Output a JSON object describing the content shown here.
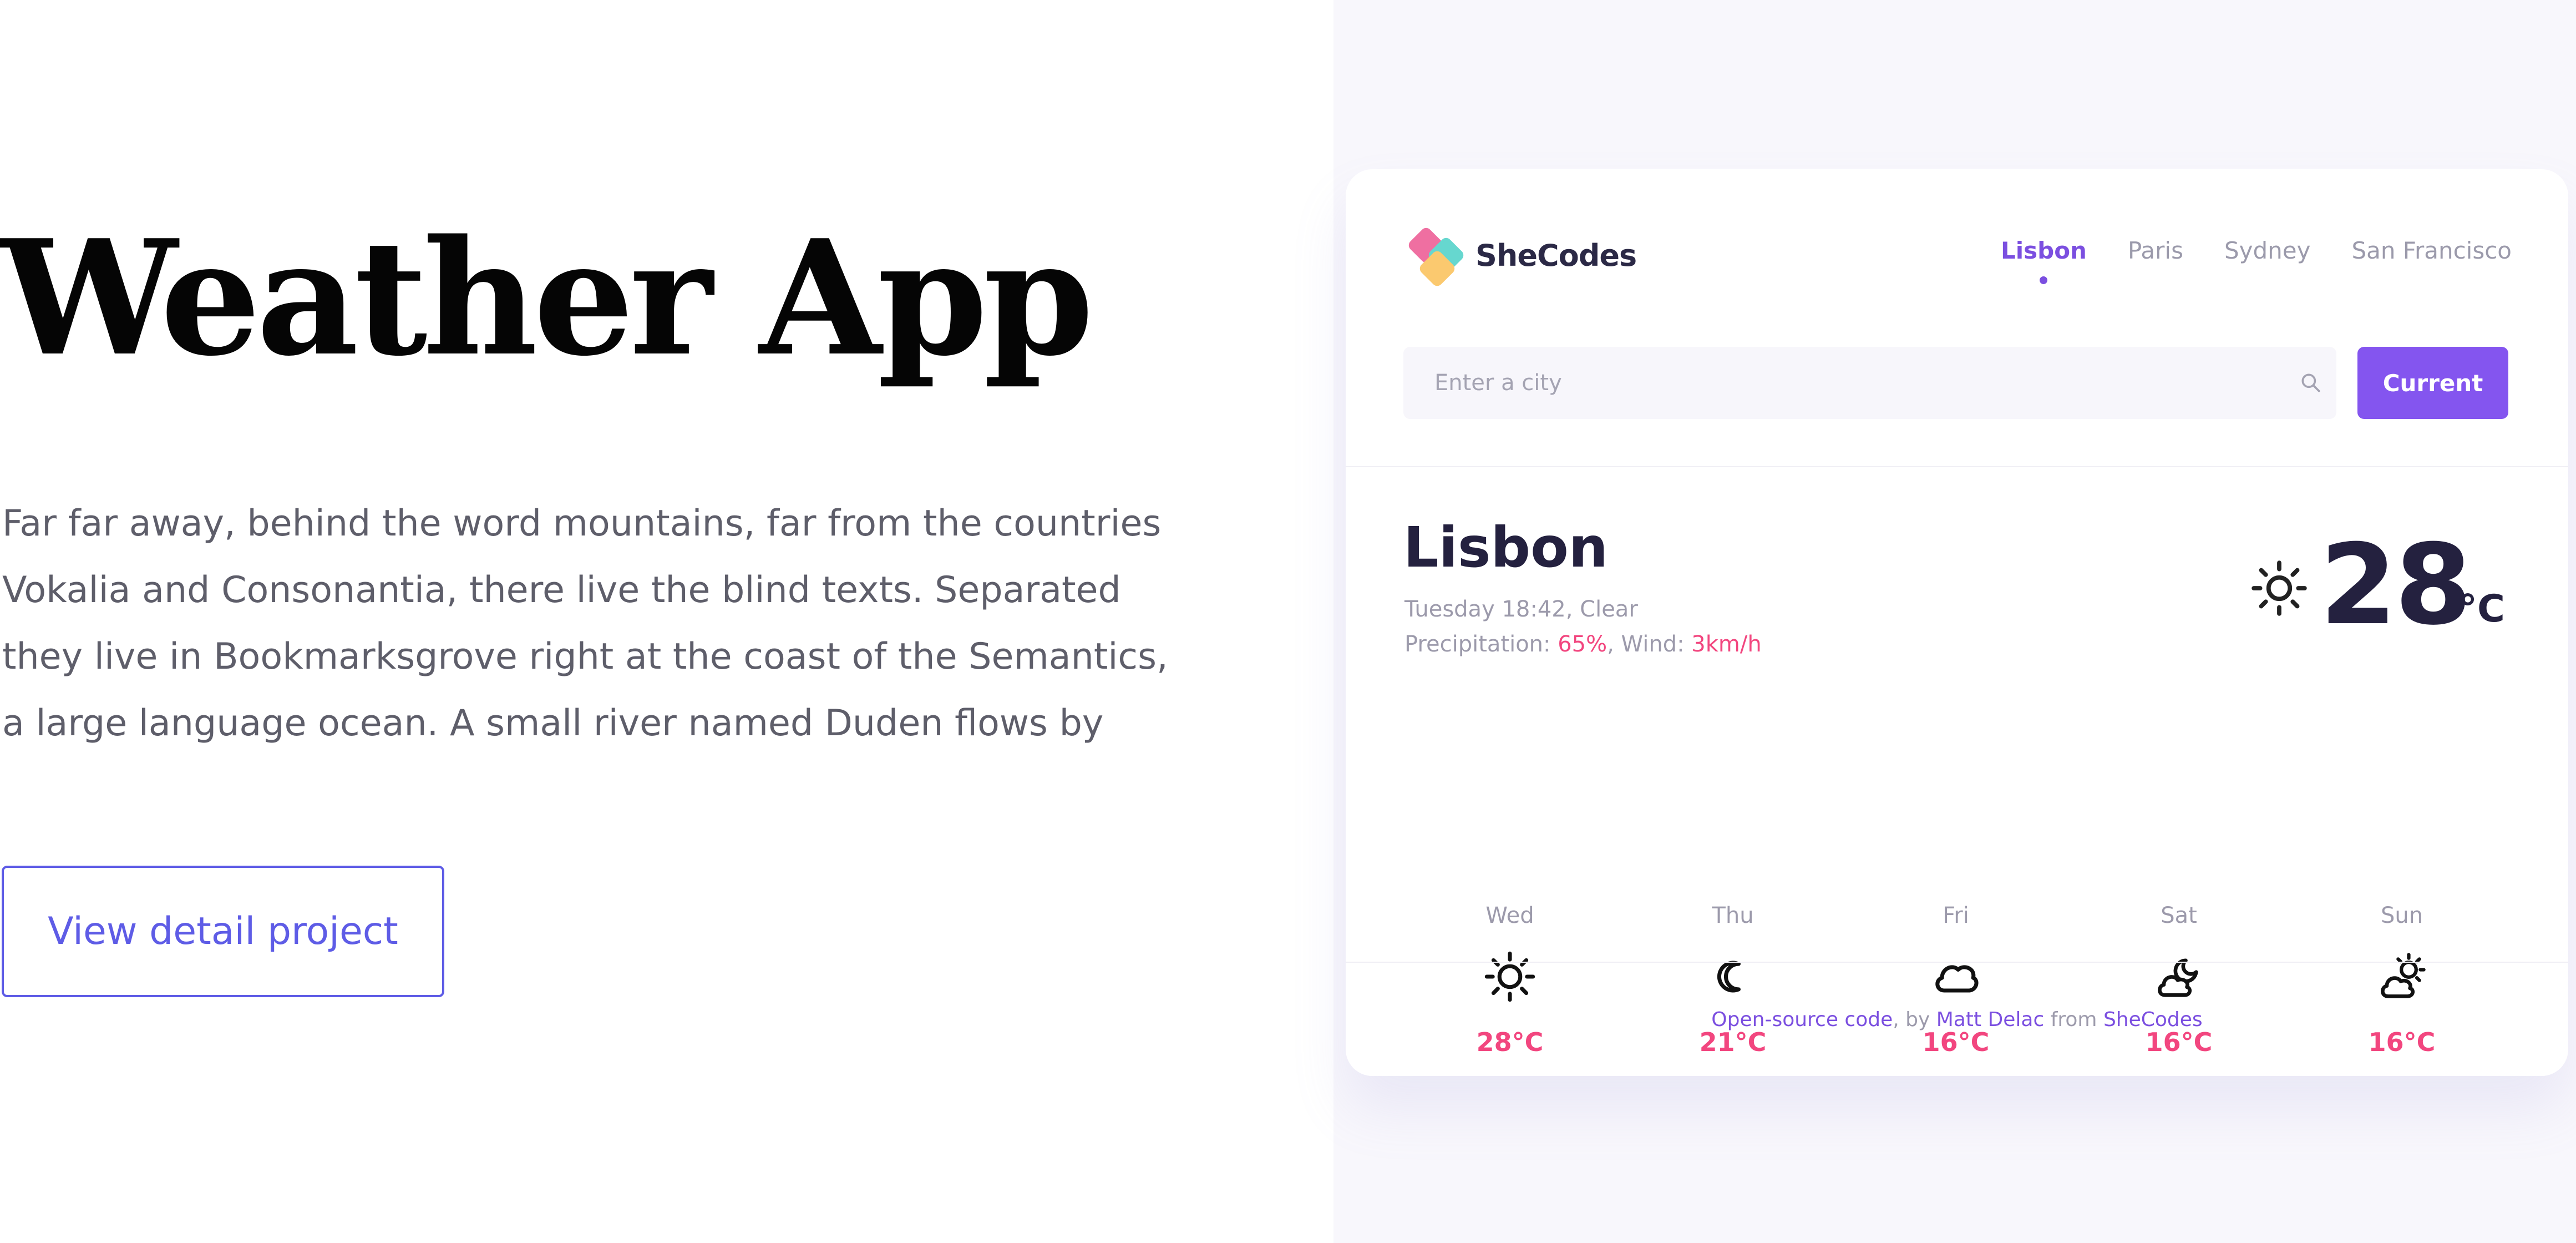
{
  "hero": {
    "title": "Weather App",
    "description_lines": [
      "Far far away, behind the word mountains, far from the countries",
      "Vokalia and Consonantia, there live the blind texts. Separated",
      "they live in Bookmarksgrove right at the coast of the Semantics,",
      "a large language ocean. A small river named Duden flows by"
    ],
    "button_label": "View detail project"
  },
  "app": {
    "brand": "SheCodes",
    "city_tabs": [
      "Lisbon",
      "Paris",
      "Sydney",
      "San Francisco"
    ],
    "active_tab": "Lisbon",
    "search": {
      "placeholder": "Enter a city",
      "value": "",
      "button_label": "Current"
    },
    "current": {
      "city": "Lisbon",
      "datetime": "Tuesday 18:42, Clear",
      "precipitation_label": "Precipitation: ",
      "precipitation": "65%",
      "wind_label": ", Wind: ",
      "wind": "3km/h",
      "icon": "sun-icon",
      "temperature": "28",
      "unit": "°C"
    },
    "forecast": [
      {
        "day": "Wed",
        "icon": "sun-icon",
        "temp": "28°C"
      },
      {
        "day": "Thu",
        "icon": "moon-icon",
        "temp": "21°C"
      },
      {
        "day": "Fri",
        "icon": "cloud-icon",
        "temp": "16°C"
      },
      {
        "day": "Sat",
        "icon": "cloud-moon-icon",
        "temp": "16°C"
      },
      {
        "day": "Sun",
        "icon": "cloud-sun-icon",
        "temp": "16°C"
      }
    ],
    "footer": {
      "code_link": "Open-source code",
      "by_text": ", by ",
      "author_link": "Matt Delac",
      "from_text": " from ",
      "org_link": "SheCodes"
    }
  },
  "colors": {
    "accent": "#8455ef",
    "tab_active": "#7b4fe0",
    "highlight": "#f2467f",
    "link_blue": "#5e5ce6",
    "dark_text": "#24213f",
    "right_panel_bg": "#f8f7fc"
  }
}
